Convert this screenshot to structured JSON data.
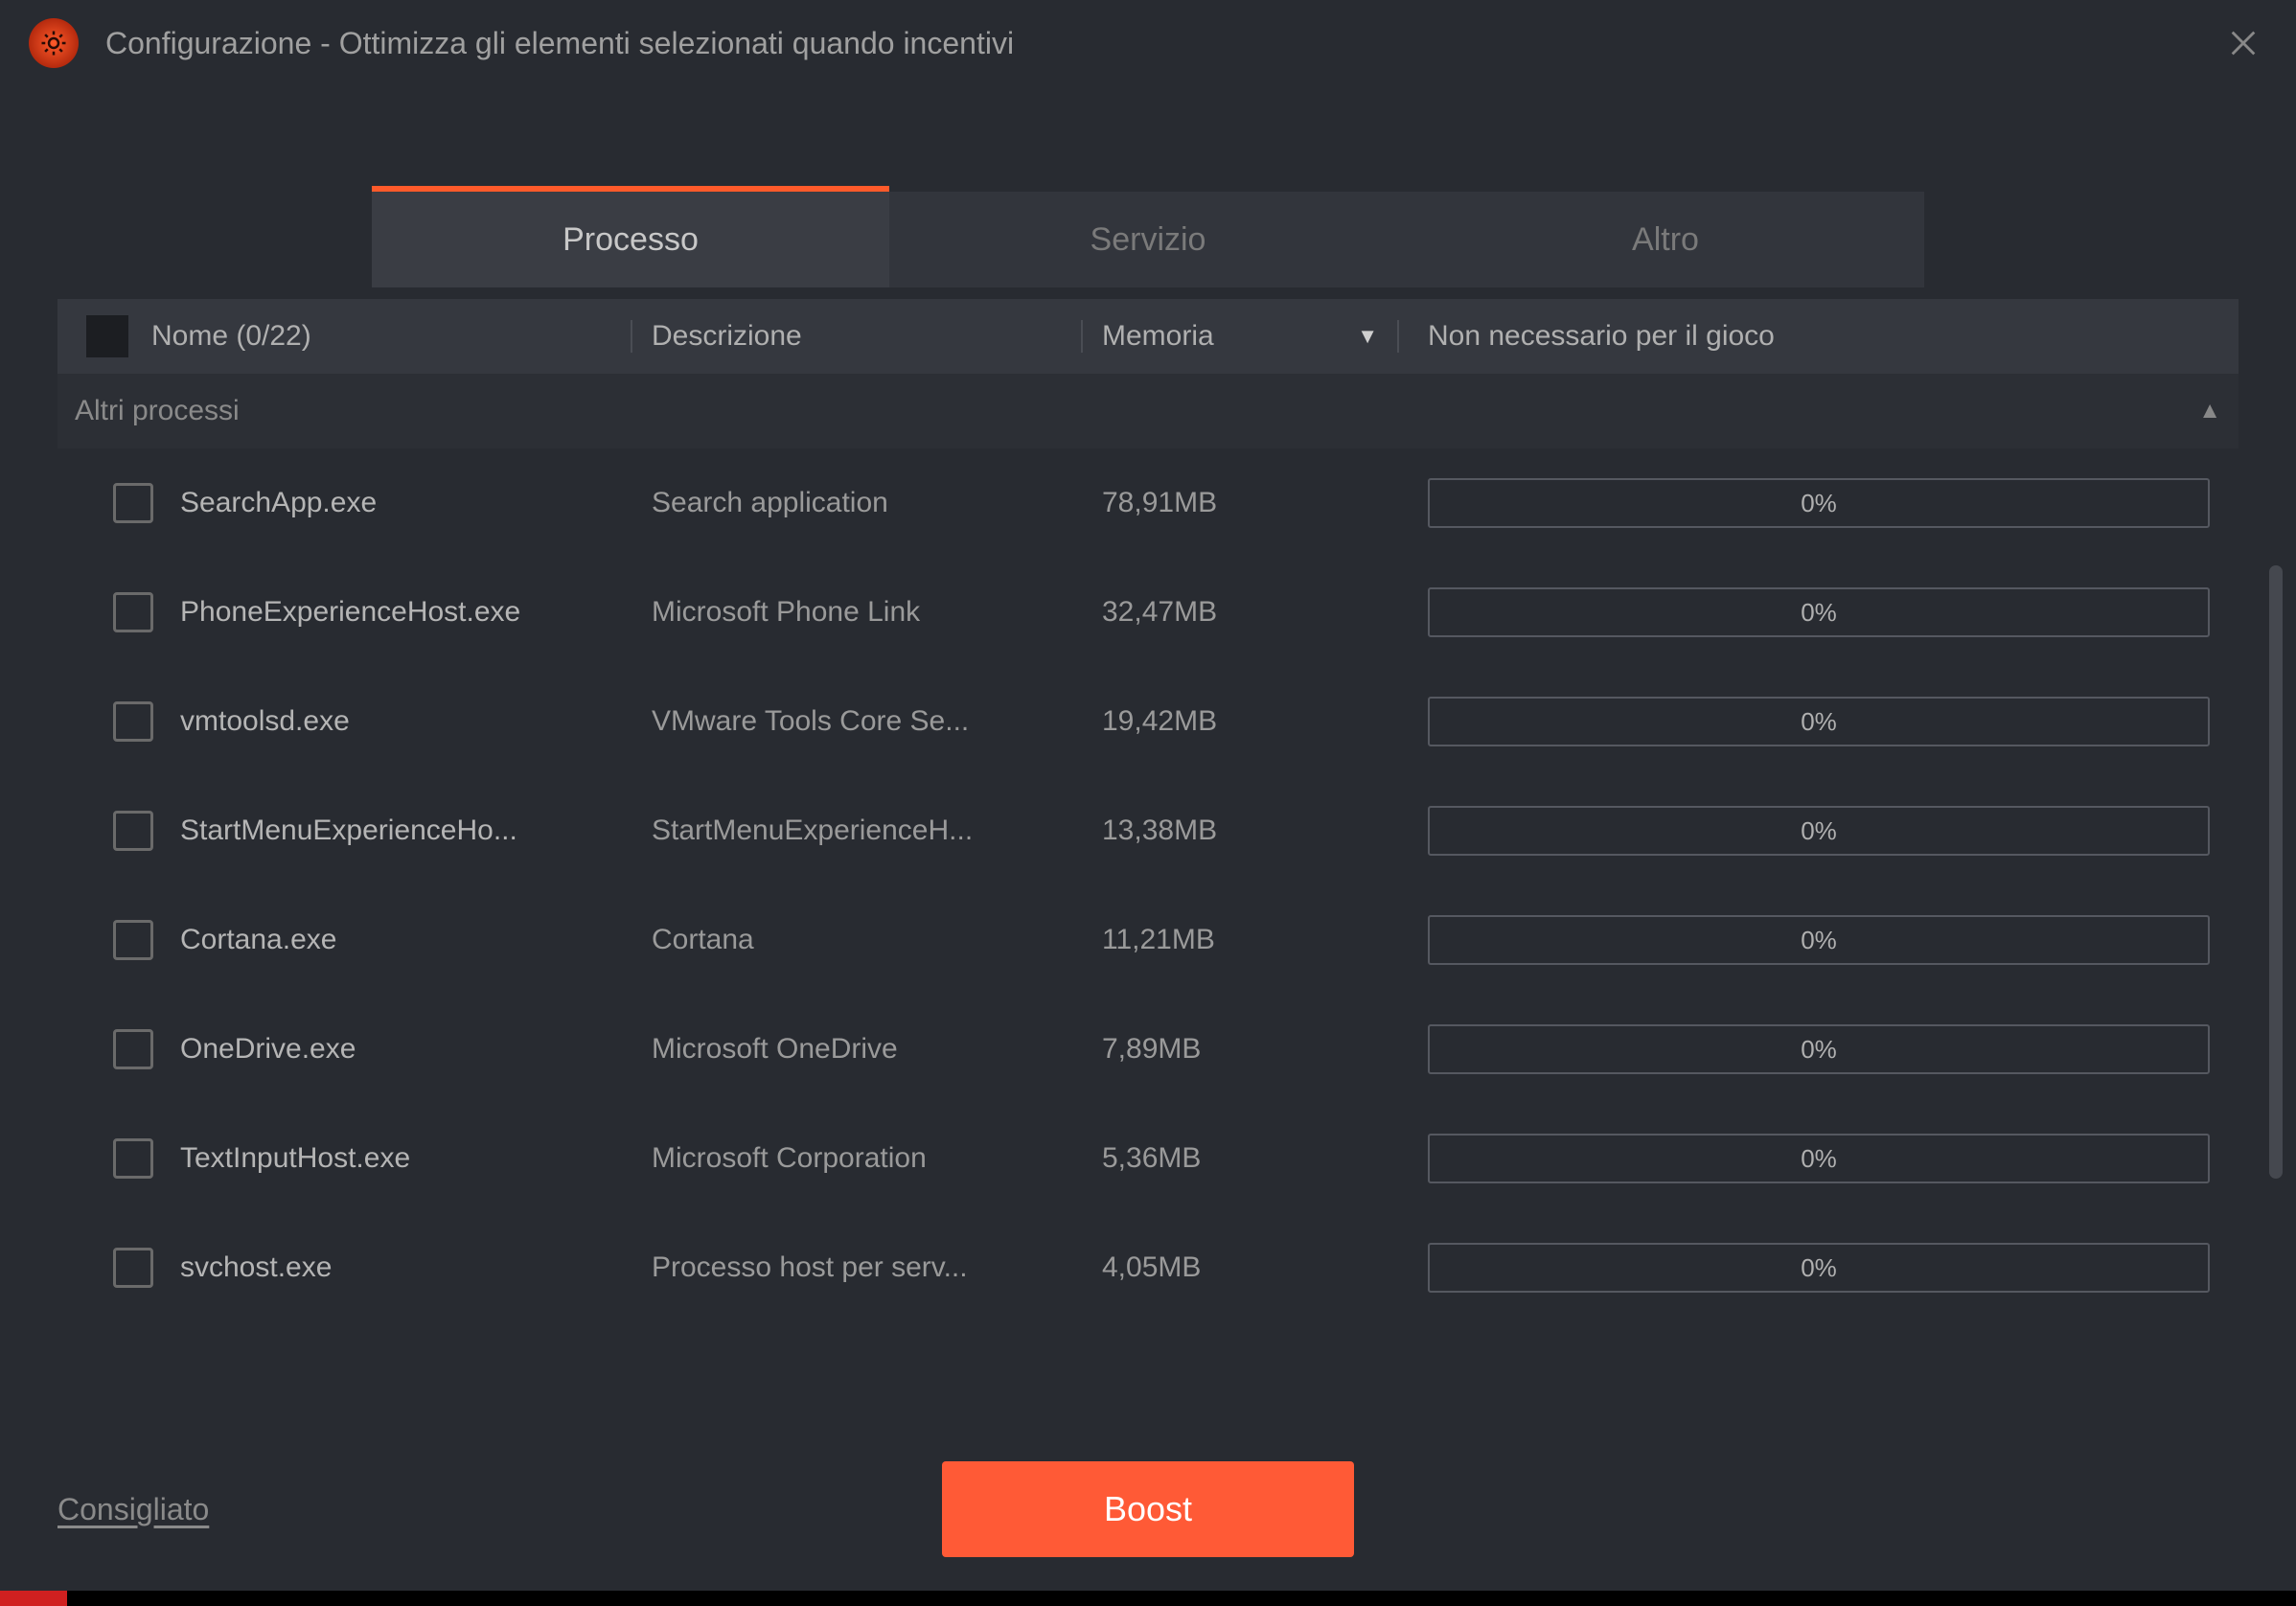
{
  "titlebar": {
    "title": "Configurazione - Ottimizza gli elementi selezionati quando incentivi"
  },
  "tabs": {
    "processo": "Processo",
    "servizio": "Servizio",
    "altro": "Altro"
  },
  "columns": {
    "name": "Nome (0/22)",
    "description": "Descrizione",
    "memory": "Memoria",
    "not_needed": "Non necessario per il gioco"
  },
  "group": {
    "label": "Altri processi"
  },
  "rows": [
    {
      "name": "SearchApp.exe",
      "desc": "Search application",
      "mem": "78,91MB",
      "pct": "0%"
    },
    {
      "name": "PhoneExperienceHost.exe",
      "desc": "Microsoft Phone Link",
      "mem": "32,47MB",
      "pct": "0%"
    },
    {
      "name": "vmtoolsd.exe",
      "desc": "VMware Tools Core Se...",
      "mem": "19,42MB",
      "pct": "0%"
    },
    {
      "name": "StartMenuExperienceHo...",
      "desc": "StartMenuExperienceH...",
      "mem": "13,38MB",
      "pct": "0%"
    },
    {
      "name": "Cortana.exe",
      "desc": "Cortana",
      "mem": "11,21MB",
      "pct": "0%"
    },
    {
      "name": "OneDrive.exe",
      "desc": "Microsoft OneDrive",
      "mem": "7,89MB",
      "pct": "0%"
    },
    {
      "name": "TextInputHost.exe",
      "desc": "Microsoft Corporation",
      "mem": "5,36MB",
      "pct": "0%"
    },
    {
      "name": "svchost.exe",
      "desc": "Processo host per serv...",
      "mem": "4,05MB",
      "pct": "0%"
    }
  ],
  "footer": {
    "recommended": "Consigliato",
    "boost": "Boost"
  }
}
